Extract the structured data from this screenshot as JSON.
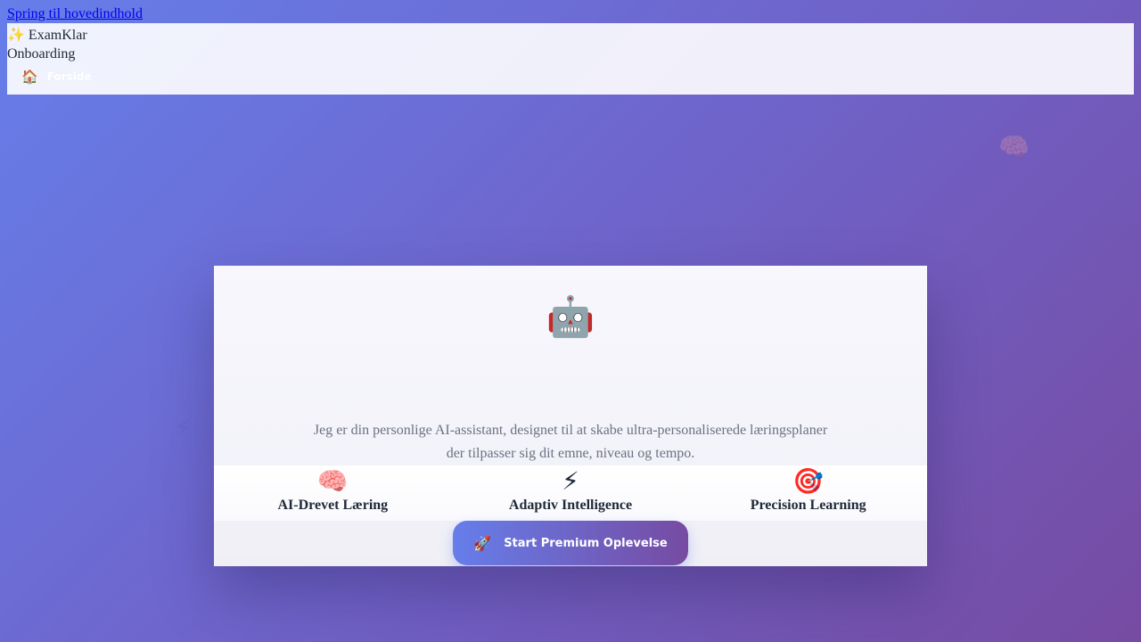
{
  "skip_link": "Spring til hovedindhold",
  "header": {
    "brand_icon": "✨",
    "brand_name": "ExamKlar",
    "section": "Onboarding",
    "nav_home_icon": "🏠",
    "nav_home_label": "Forside"
  },
  "background_icons": {
    "brain": "🧠",
    "bolt": "⚡"
  },
  "card": {
    "avatar_icon": "🤖",
    "intro_line1": "Jeg er din personlige AI-assistant, designet til at skabe ultra-personaliserede læringsplaner",
    "intro_line2": "der tilpasser sig dit emne, niveau og tempo.",
    "features": [
      {
        "icon": "🧠",
        "title": "AI-Drevet Læring"
      },
      {
        "icon": "⚡",
        "title": "Adaptiv Intelligence"
      },
      {
        "icon": "🎯",
        "title": "Precision Learning"
      }
    ],
    "cta_icon": "🚀",
    "cta_label": "Start Premium Oplevelse"
  },
  "colors": {
    "gradient_start": "#667eea",
    "gradient_end": "#764ba2",
    "text_muted": "#6b7280",
    "text_dark": "#1f2937"
  }
}
